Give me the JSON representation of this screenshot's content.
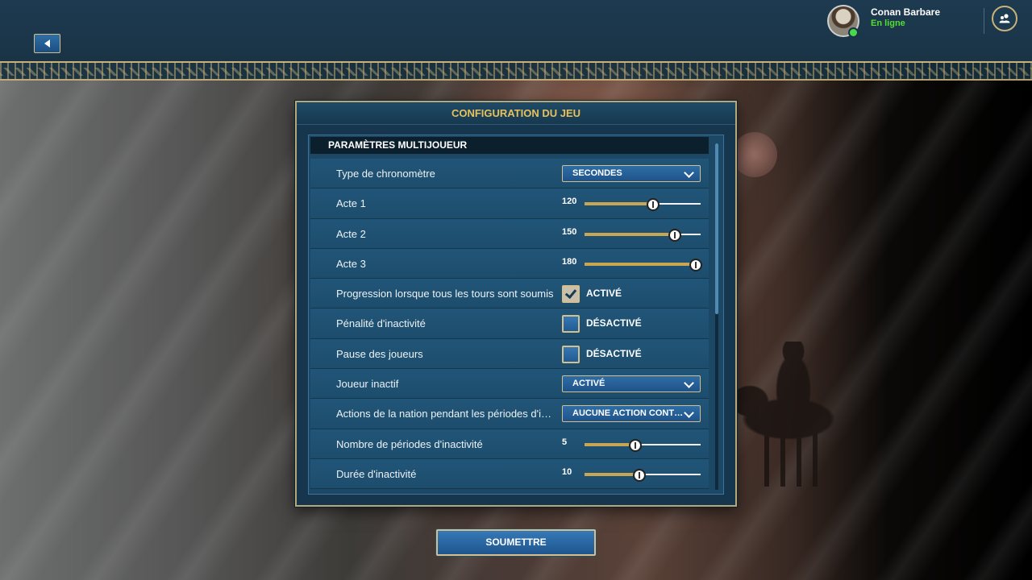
{
  "user": {
    "name": "Conan Barbare",
    "status": "En ligne"
  },
  "dialog": {
    "title": "CONFIGURATION DU JEU",
    "section": "PARAMÈTRES MULTIJOUEUR",
    "rows": [
      {
        "label": "Type de chronomètre",
        "type": "dropdown",
        "value": "SECONDES"
      },
      {
        "label": "Acte 1",
        "type": "slider",
        "value": "120",
        "fraction": 0.59
      },
      {
        "label": "Acte 2",
        "type": "slider",
        "value": "150",
        "fraction": 0.78
      },
      {
        "label": "Acte 3",
        "type": "slider",
        "value": "180",
        "fraction": 0.96
      },
      {
        "label": "Progression lorsque tous les tours sont soumis",
        "type": "checkbox",
        "checked": true,
        "value": "ACTIVÉ"
      },
      {
        "label": "Pénalité d'inactivité",
        "type": "checkbox",
        "checked": false,
        "value": "DÉSACTIVÉ"
      },
      {
        "label": "Pause des joueurs",
        "type": "checkbox",
        "checked": false,
        "value": "DÉSACTIVÉ"
      },
      {
        "label": "Joueur inactif",
        "type": "dropdown",
        "value": "ACTIVÉ"
      },
      {
        "label": "Actions de la nation pendant les périodes d'inactivité",
        "type": "dropdown",
        "value": "AUCUNE ACTION CONTINUE"
      },
      {
        "label": "Nombre de périodes d'inactivité",
        "type": "slider",
        "value": "5",
        "fraction": 0.44
      },
      {
        "label": "Durée d'inactivité",
        "type": "slider",
        "value": "10",
        "fraction": 0.47
      }
    ]
  },
  "submit_label": "SOUMETTRE",
  "colors": {
    "accent_gold": "#c9b27a",
    "title_gold": "#e8c15a",
    "online_green": "#55dd33",
    "button_blue": "#2e6da4"
  },
  "icons": {
    "back": "left-triangle-icon",
    "social": "friends-icon",
    "chevron": "chevron-down-icon",
    "check": "checkmark-icon"
  }
}
